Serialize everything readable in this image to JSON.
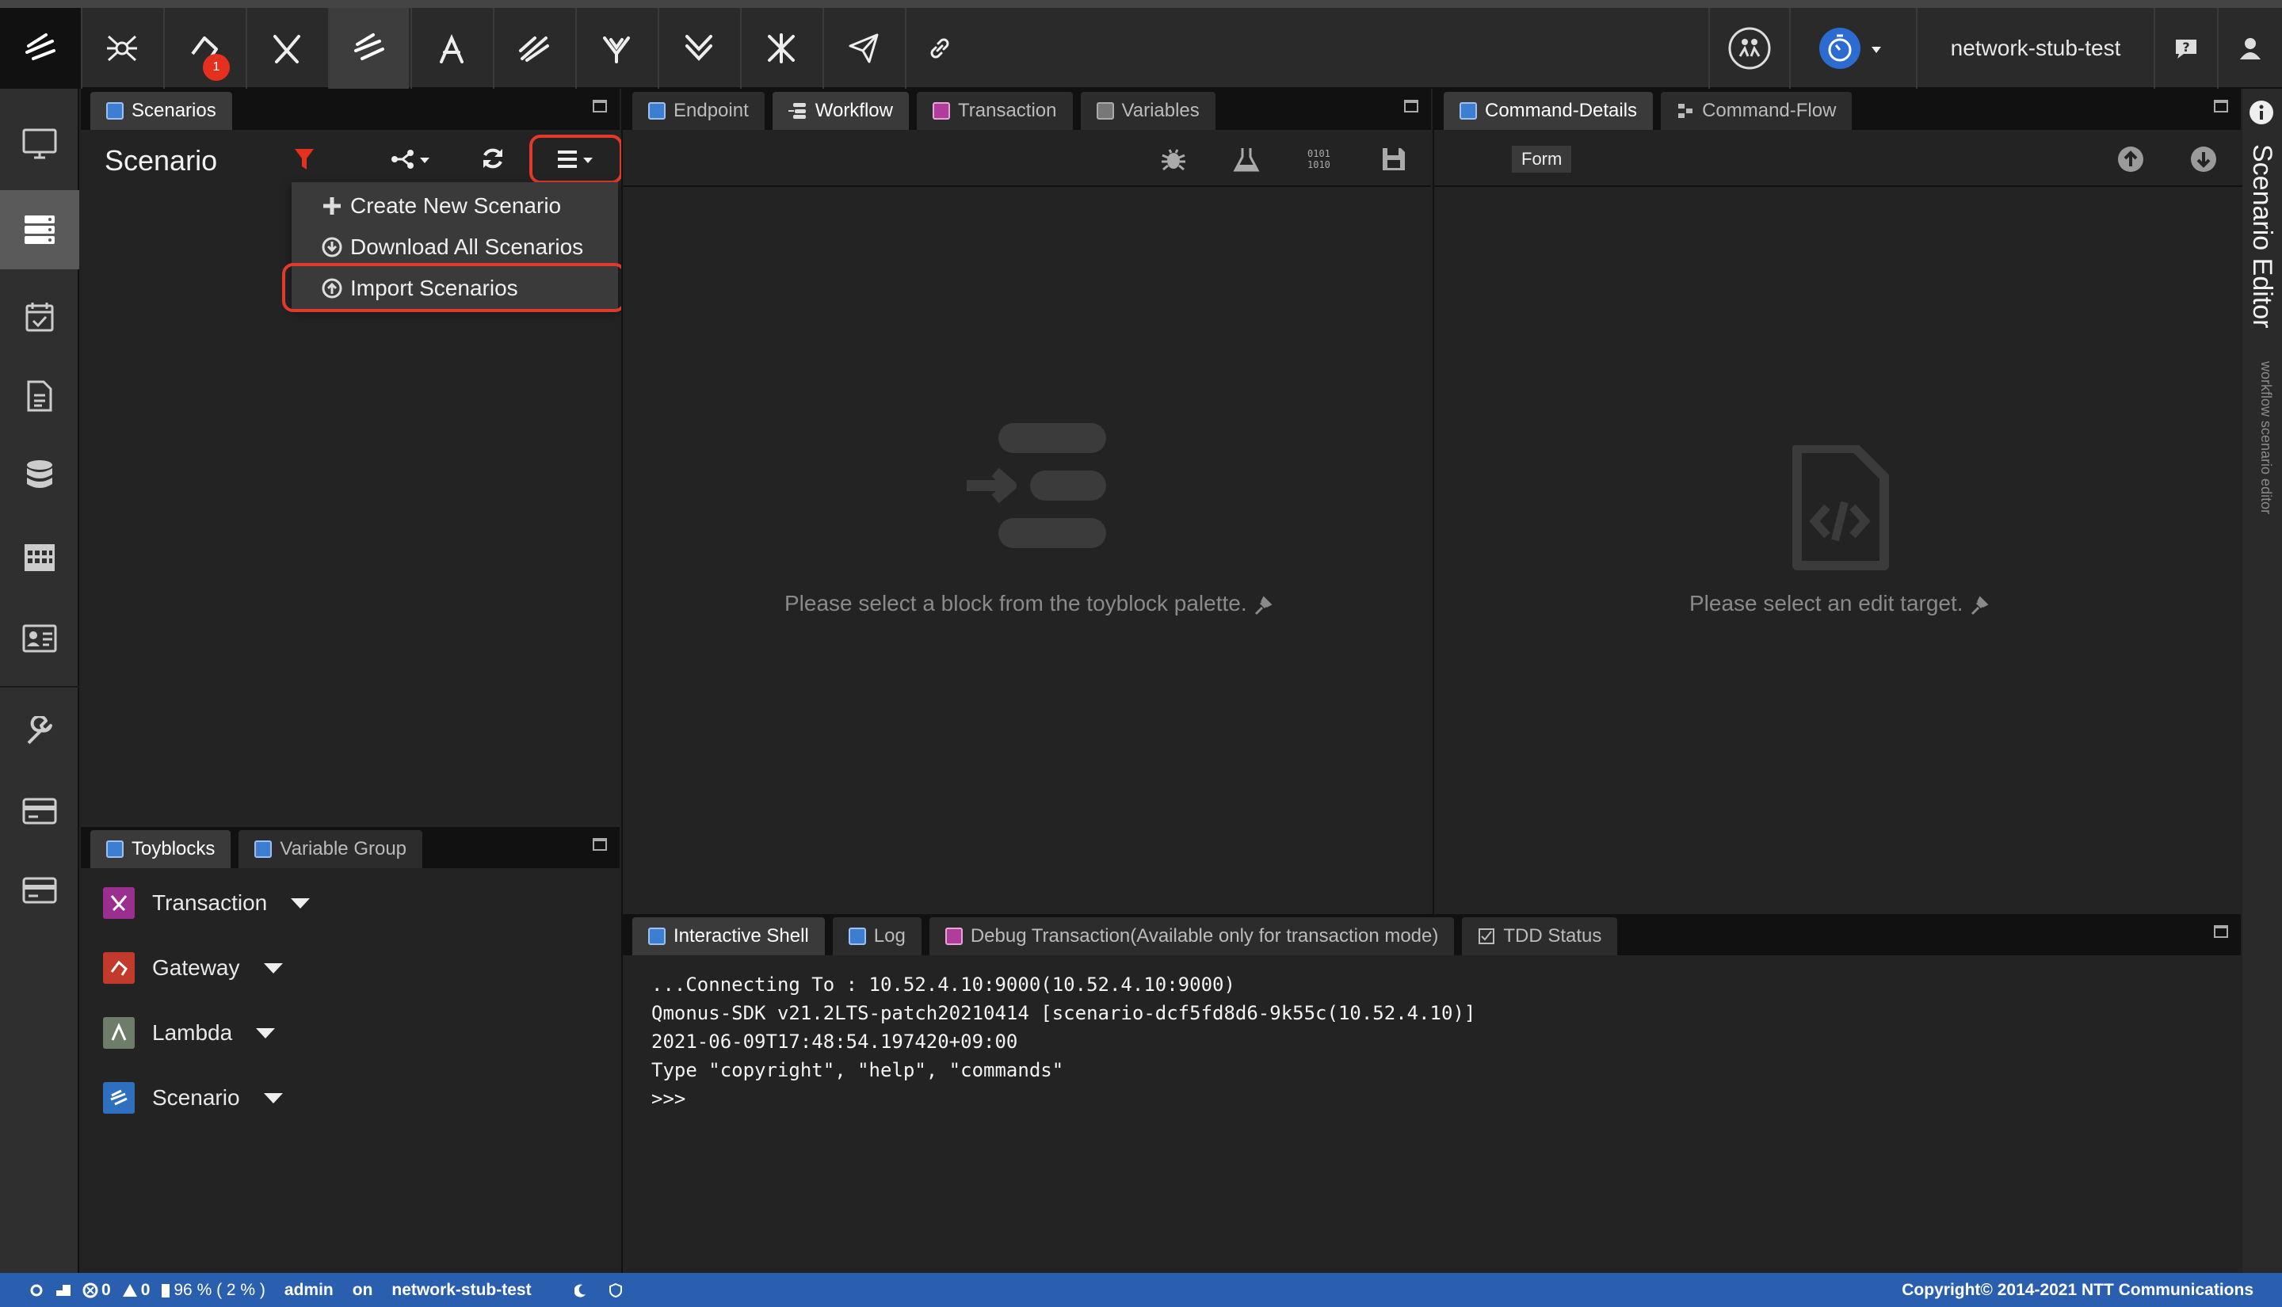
{
  "topbar": {
    "notification_count": "1",
    "project_name": "network-stub-test",
    "icons": [
      "logo-icon",
      "spider-icon",
      "gateway-icon",
      "transaction-icon",
      "scenario-icon",
      "lambda-icon",
      "flow-icon",
      "service-icon",
      "component-icon",
      "module-icon",
      "rocket-icon",
      "link-icon",
      "team-icon",
      "timer-icon",
      "help-icon",
      "user-icon"
    ]
  },
  "sidebar": {
    "items": [
      "monitor-icon",
      "server-list-icon",
      "calendar-check-icon",
      "document-icon",
      "database-icon",
      "calendar-grid-icon",
      "id-card-icon",
      "wrench-icon",
      "card-icon",
      "card-alt-icon"
    ]
  },
  "scenarios_panel": {
    "tab_label": "Scenarios",
    "title": "Scenario",
    "menu": {
      "create": "Create New Scenario",
      "download": "Download All Scenarios",
      "import": "Import Scenarios"
    }
  },
  "toyblocks_panel": {
    "tabs": [
      "Toyblocks",
      "Variable Group"
    ],
    "items": [
      {
        "label": "Transaction",
        "color": "#9b2f8f"
      },
      {
        "label": "Gateway",
        "color": "#c23a2c"
      },
      {
        "label": "Lambda",
        "color": "#6d7d6a"
      },
      {
        "label": "Scenario",
        "color": "#2f6fc0"
      }
    ]
  },
  "workflow_panel": {
    "tabs": [
      "Endpoint",
      "Workflow",
      "Transaction",
      "Variables"
    ],
    "placeholder": "Please select a block from the toyblock palette."
  },
  "details_panel": {
    "tabs": [
      "Command-Details",
      "Command-Flow"
    ],
    "form_button": "Form",
    "placeholder": "Please select an edit target."
  },
  "shell_panel": {
    "tabs": [
      "Interactive Shell",
      "Log",
      "Debug Transaction(Available only for transaction mode)",
      "TDD Status"
    ],
    "lines": [
      "...Connecting To : 10.52.4.10:9000(10.52.4.10:9000)",
      "Qmonus-SDK v21.2LTS-patch20210414 [scenario-dcf5fd8d6-9k55c(10.52.4.10)]",
      "2021-06-09T17:48:54.197420+09:00",
      "Type \"copyright\", \"help\", \"commands\"",
      ">>>"
    ]
  },
  "right_rail": {
    "title": "Scenario Editor",
    "subtitle": "workflow scenario editor"
  },
  "statusbar": {
    "errors": "0",
    "warnings": "0",
    "memory": "96 % ( 2 % )",
    "user": "admin",
    "on": "on",
    "project": "network-stub-test",
    "copyright": "Copyright© 2014-2021 NTT Communications"
  },
  "colors": {
    "accent_blue": "#2a5fb0",
    "highlight_red": "#e23a2a",
    "filter_red": "#e53020"
  }
}
